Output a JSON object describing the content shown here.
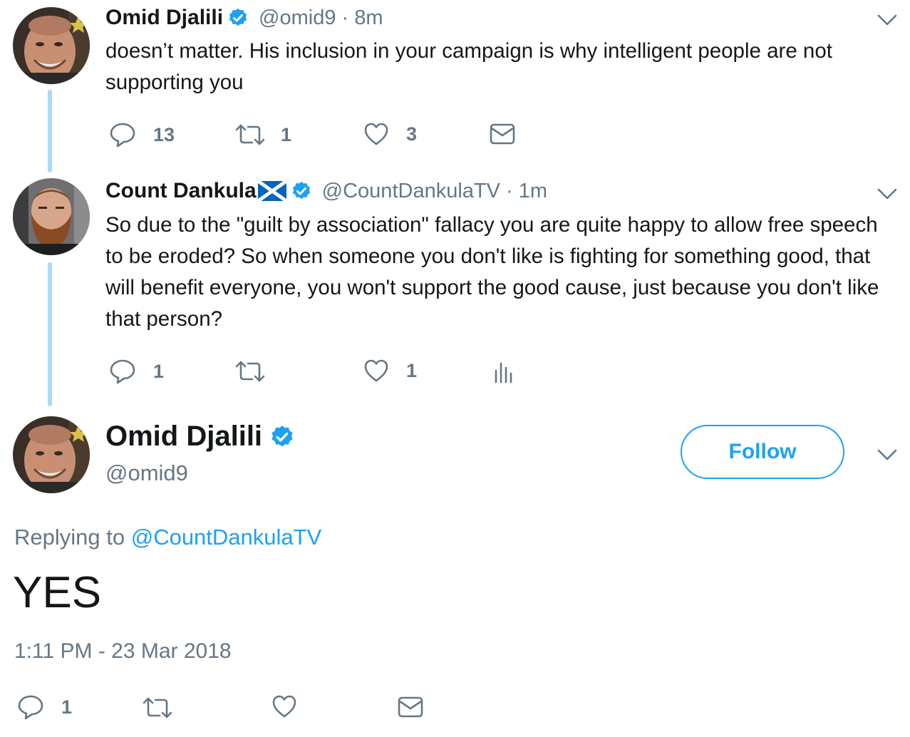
{
  "colors": {
    "accent": "#1da1f2",
    "thread_line": "#a9dbf8",
    "secondary_text": "#657786",
    "primary_text": "#14171a"
  },
  "tweet1": {
    "name": "Omid Djalili",
    "handle_time": "@omid9 · 8m",
    "verified_icon": "verified-badge-icon",
    "text": "doesn’t matter. His inclusion in your campaign is why intelligent people are not supporting you",
    "reply_count": "13",
    "retweet_count": "1",
    "like_count": "3",
    "dm_icon": "envelope-icon"
  },
  "tweet2": {
    "name": "Count Dankula",
    "flag_icon": "scotland-flag-icon",
    "handle_time": "@CountDankulaTV · 1m",
    "text": "So due to the \"guilt by association\" fallacy you are quite happy to allow free speech to be eroded? So when someone you don't like is fighting for something good, that will benefit everyone, you won't support the good cause, just because you don't like that person?",
    "reply_count": "1",
    "retweet_count": "",
    "like_count": "1",
    "analytics_icon": "analytics-icon"
  },
  "main_tweet": {
    "name": "Omid Djalili",
    "handle": "@omid9",
    "follow_label": "Follow",
    "replying_prefix": "Replying to ",
    "replying_handle": "@CountDankulaTV",
    "text": "YES",
    "timestamp": "1:11 PM - 23 Mar 2018",
    "reply_count": "1"
  }
}
